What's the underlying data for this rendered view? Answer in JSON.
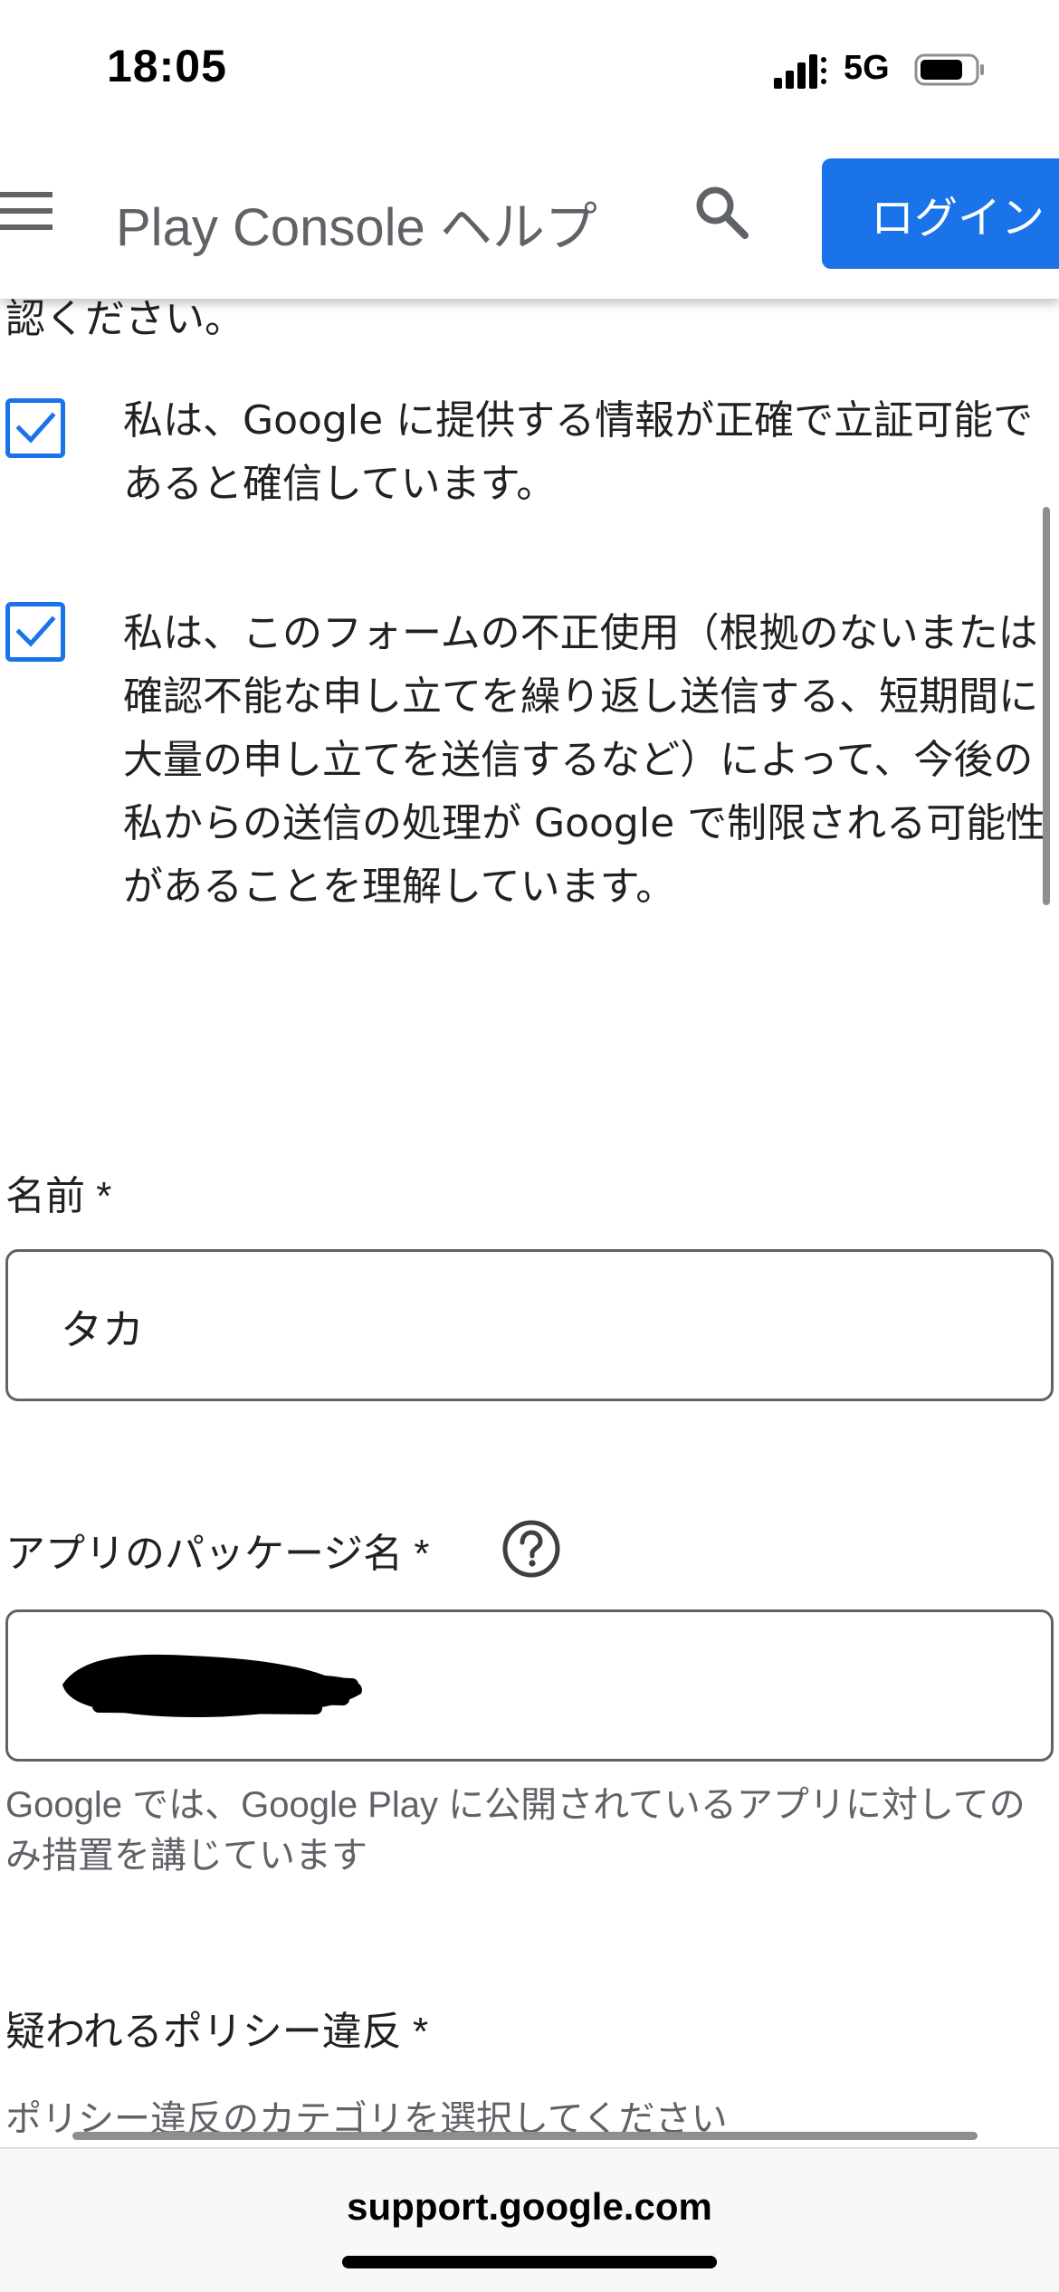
{
  "status_bar": {
    "time": "18:05",
    "network": "5G"
  },
  "header": {
    "title": "Play Console ヘルプ",
    "login_label": "ログイン"
  },
  "content": {
    "cut_text": "認ください。",
    "checkboxes": [
      {
        "checked": true,
        "text": "私は、Google に提供する情報が正確で立証可能であると確信しています。"
      },
      {
        "checked": true,
        "text": "私は、このフォームの不正使用（根拠のないまたは確認不能な申し立てを繰り返し送信する、短期間に大量の申し立てを送信するなど）によって、今後の私からの送信の処理が Google で制限される可能性があることを理解しています。"
      }
    ],
    "name_field": {
      "label": "名前 *",
      "value": "タカ"
    },
    "package_field": {
      "label": "アプリのパッケージ名 *",
      "helper": "Google では、Google Play に公開されているアプリに対してのみ措置を講じています"
    },
    "policy_field": {
      "label": "疑われるポリシー違反 *",
      "placeholder": "ポリシー違反のカテゴリを選択してください"
    }
  },
  "browser": {
    "url": "support.google.com"
  },
  "colors": {
    "accent": "#1a73e8",
    "text": "#202124",
    "secondary_text": "#5f6368"
  }
}
